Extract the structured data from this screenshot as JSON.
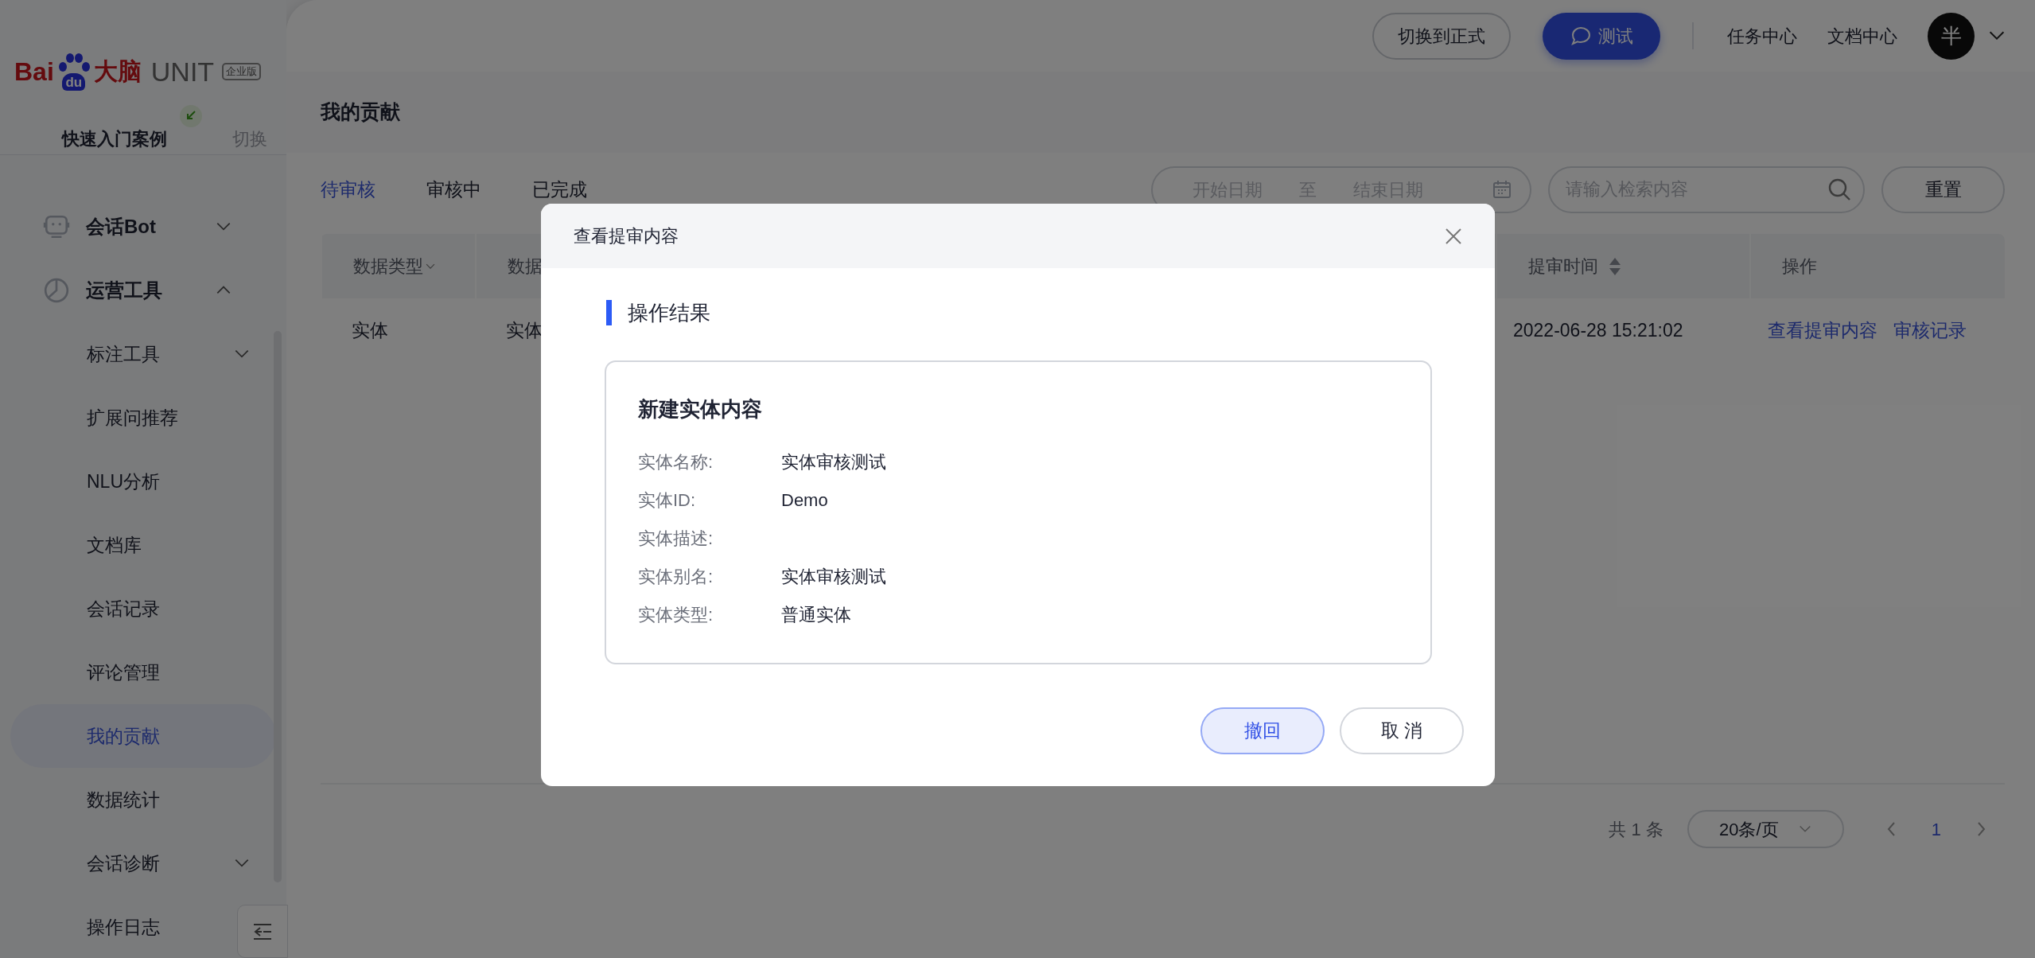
{
  "sidebar": {
    "logo": {
      "text_1": "Bai",
      "paw_text": "du",
      "text_2": "大脑",
      "product": "UNIT",
      "edition": "企业版"
    },
    "project": {
      "name": "快速入门案例",
      "switch": "切换"
    },
    "nav": [
      {
        "label": "会话Bot",
        "expanded": false
      },
      {
        "label": "运营工具",
        "expanded": true,
        "children": [
          {
            "label": "标注工具",
            "kind": "folder",
            "expanded": false,
            "selected": false
          },
          {
            "label": "扩展问推荐",
            "kind": "page",
            "selected": false
          },
          {
            "label": "NLU分析",
            "kind": "page",
            "selected": false
          },
          {
            "label": "文档库",
            "kind": "page",
            "selected": false
          },
          {
            "label": "会话记录",
            "kind": "page",
            "selected": false
          },
          {
            "label": "评论管理",
            "kind": "page",
            "selected": false
          },
          {
            "label": "我的贡献",
            "kind": "page",
            "selected": true
          },
          {
            "label": "数据统计",
            "kind": "page",
            "selected": false
          },
          {
            "label": "会话诊断",
            "kind": "folder",
            "expanded": false,
            "selected": false
          },
          {
            "label": "操作日志",
            "kind": "page",
            "selected": false
          }
        ]
      }
    ]
  },
  "topbar": {
    "env_button": "切换到正式",
    "test_button": "测试",
    "links": [
      "任务中心",
      "文档中心"
    ],
    "avatar": "半"
  },
  "page_title": "我的贡献",
  "tabs": [
    {
      "label": "待审核",
      "selected": true
    },
    {
      "label": "审核中",
      "selected": false
    },
    {
      "label": "已完成",
      "selected": false
    }
  ],
  "date_range": {
    "start_placeholder": "开始日期",
    "separator": "至",
    "end_placeholder": "结束日期"
  },
  "search": {
    "placeholder": "请输入检索内容"
  },
  "reset_button": "重置",
  "table": {
    "columns": [
      {
        "label": "数据类型",
        "filter": true,
        "sortable": false
      },
      {
        "label": "数据"
      },
      {
        "label": "提审时间",
        "filter": false,
        "sortable": true
      },
      {
        "label": "操作",
        "filter": false,
        "sortable": false
      }
    ],
    "rows": [
      {
        "cells": [
          "实体",
          "实体",
          "2022-06-28 15:21:02"
        ],
        "actions": [
          "查看提审内容",
          "审核记录"
        ]
      }
    ]
  },
  "pagination": {
    "total": "共 1 条",
    "page_size": "20条/页",
    "pages": [
      {
        "label": "1",
        "selected": true
      }
    ]
  },
  "modal": {
    "title": "查看提审内容",
    "section": "操作结果",
    "card_title": "新建实体内容",
    "fields": [
      {
        "label": "实体名称:",
        "value": "实体审核测试"
      },
      {
        "label": "实体ID:",
        "value": "Demo"
      },
      {
        "label": "实体描述:"
      },
      {
        "label": "实体别名:",
        "value": "实体审核测试"
      },
      {
        "label": "实体类型:",
        "value": "普通实体"
      }
    ],
    "buttons": [
      {
        "label": "撤回",
        "kind": "primary"
      },
      {
        "label": "取 消",
        "kind": "default"
      }
    ]
  }
}
